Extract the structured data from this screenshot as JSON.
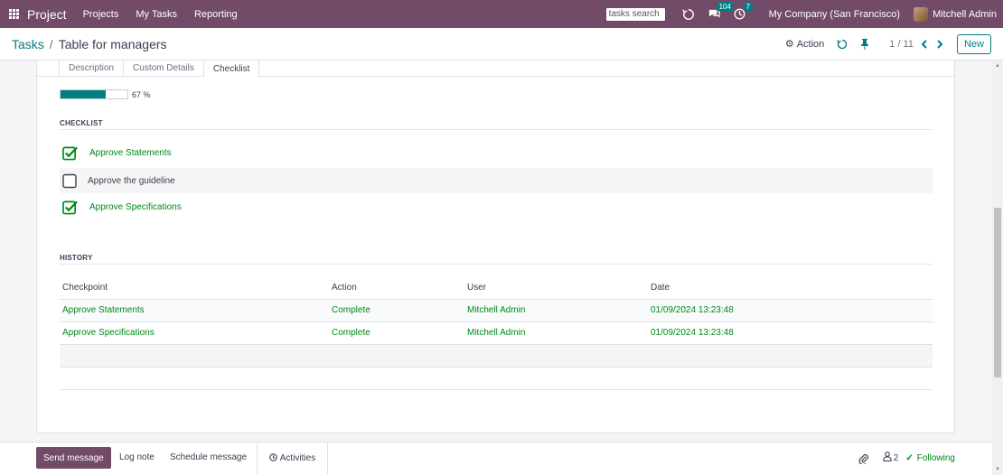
{
  "navbar": {
    "brand": "Project",
    "links": [
      "Projects",
      "My Tasks",
      "Reporting"
    ],
    "search_value": "tasks search",
    "chat_badge": "104",
    "activity_badge": "7",
    "company": "My Company (San Francisco)",
    "user": "Mitchell Admin",
    "color": "#714b67"
  },
  "control": {
    "breadcrumb_root": "Tasks",
    "breadcrumb_sep": "/",
    "breadcrumb_current": "Table for managers",
    "action_label": "Action",
    "pager": "1 / 11",
    "new_label": "New"
  },
  "tabs": [
    "Description",
    "Custom Details",
    "Checklist"
  ],
  "active_tab": "Checklist",
  "progress": {
    "value": 0.67,
    "label": "67 %"
  },
  "checklist": {
    "title": "CHECKLIST",
    "items": [
      {
        "label": "Approve Statements",
        "checked": true
      },
      {
        "label": "Approve the guideline",
        "checked": false
      },
      {
        "label": "Approve Specifications",
        "checked": true
      }
    ]
  },
  "history": {
    "title": "HISTORY",
    "columns": [
      "Checkpoint",
      "Action",
      "User",
      "Date"
    ],
    "rows": [
      [
        "Approve Statements",
        "Complete",
        "Mitchell Admin",
        "01/09/2024 13:23:48"
      ],
      [
        "Approve Specifications",
        "Complete",
        "Mitchell Admin",
        "01/09/2024 13:23:48"
      ]
    ]
  },
  "chatter": {
    "send_message": "Send message",
    "log_note": "Log note",
    "schedule_message": "Schedule message",
    "activities": "Activities",
    "followers_count": "2",
    "following": "Following"
  },
  "colors": {
    "accent": "#017e84",
    "success": "#008818",
    "brand": "#714b67"
  }
}
